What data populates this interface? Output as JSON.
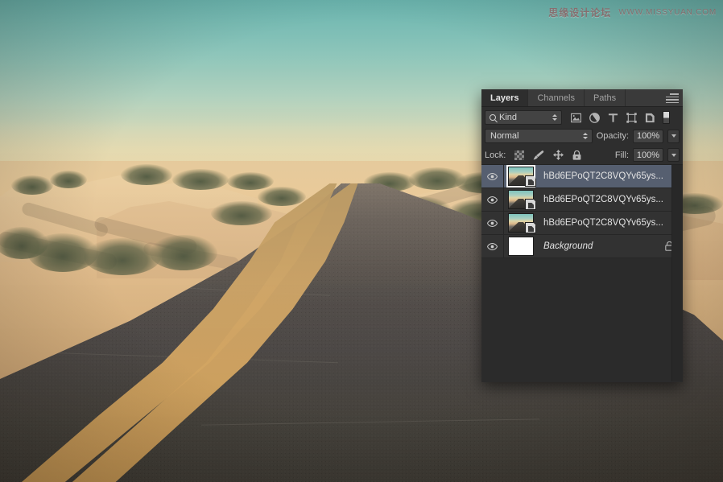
{
  "watermark": {
    "chinese": "思缘设计论坛",
    "url": "WWW.MISSYUAN.COM"
  },
  "panel": {
    "tabs": [
      {
        "label": "Layers",
        "active": true
      },
      {
        "label": "Channels",
        "active": false
      },
      {
        "label": "Paths",
        "active": false
      }
    ],
    "menu_icon": "panel-menu-icon",
    "filter": {
      "kind_label": "Kind",
      "search_icon": "search-icon",
      "icons": [
        "pixel-layer-filter-icon",
        "adjustment-layer-filter-icon",
        "type-layer-filter-icon",
        "shape-layer-filter-icon",
        "smart-object-filter-icon"
      ],
      "toggle_name": "filter-enable-toggle"
    },
    "blend": {
      "mode": "Normal",
      "opacity_label": "Opacity:",
      "opacity_value": "100%"
    },
    "lock": {
      "label": "Lock:",
      "icons": [
        "lock-transparent-pixels-icon",
        "lock-image-pixels-icon",
        "lock-position-icon",
        "lock-all-icon"
      ],
      "fill_label": "Fill:",
      "fill_value": "100%"
    },
    "layers": [
      {
        "name": "hBd6EPoQT2C8VQYv65ys...",
        "selected": true,
        "visible": true,
        "kind": "smart-object",
        "locked": false,
        "italic": false
      },
      {
        "name": "hBd6EPoQT2C8VQYv65ys...",
        "selected": false,
        "visible": true,
        "kind": "smart-object",
        "locked": false,
        "italic": false
      },
      {
        "name": "hBd6EPoQT2C8VQYv65ys...",
        "selected": false,
        "visible": true,
        "kind": "smart-object",
        "locked": false,
        "italic": false
      },
      {
        "name": "Background",
        "selected": false,
        "visible": true,
        "kind": "background",
        "locked": true,
        "italic": true
      }
    ]
  },
  "colors": {
    "panel_bg": "#2e2e2e",
    "panel_tab_bg": "#3a3a3a",
    "layer_row_bg": "#323232",
    "layer_selected_bg": "#565f70",
    "field_bg": "#434343",
    "text": "#d0d0d0",
    "sky_top": "#69b4b0",
    "sky_bottom": "#efdcab",
    "sand": "#e6c496",
    "road": "#4e4b4a",
    "road_line": "#d3ab6d",
    "watermark": "#8f5f62"
  },
  "scene": {
    "description": "Desert highway with double yellow center line running toward the horizon, flanked by sand dunes and scrub brush under a teal-to-cream gradient sky"
  }
}
